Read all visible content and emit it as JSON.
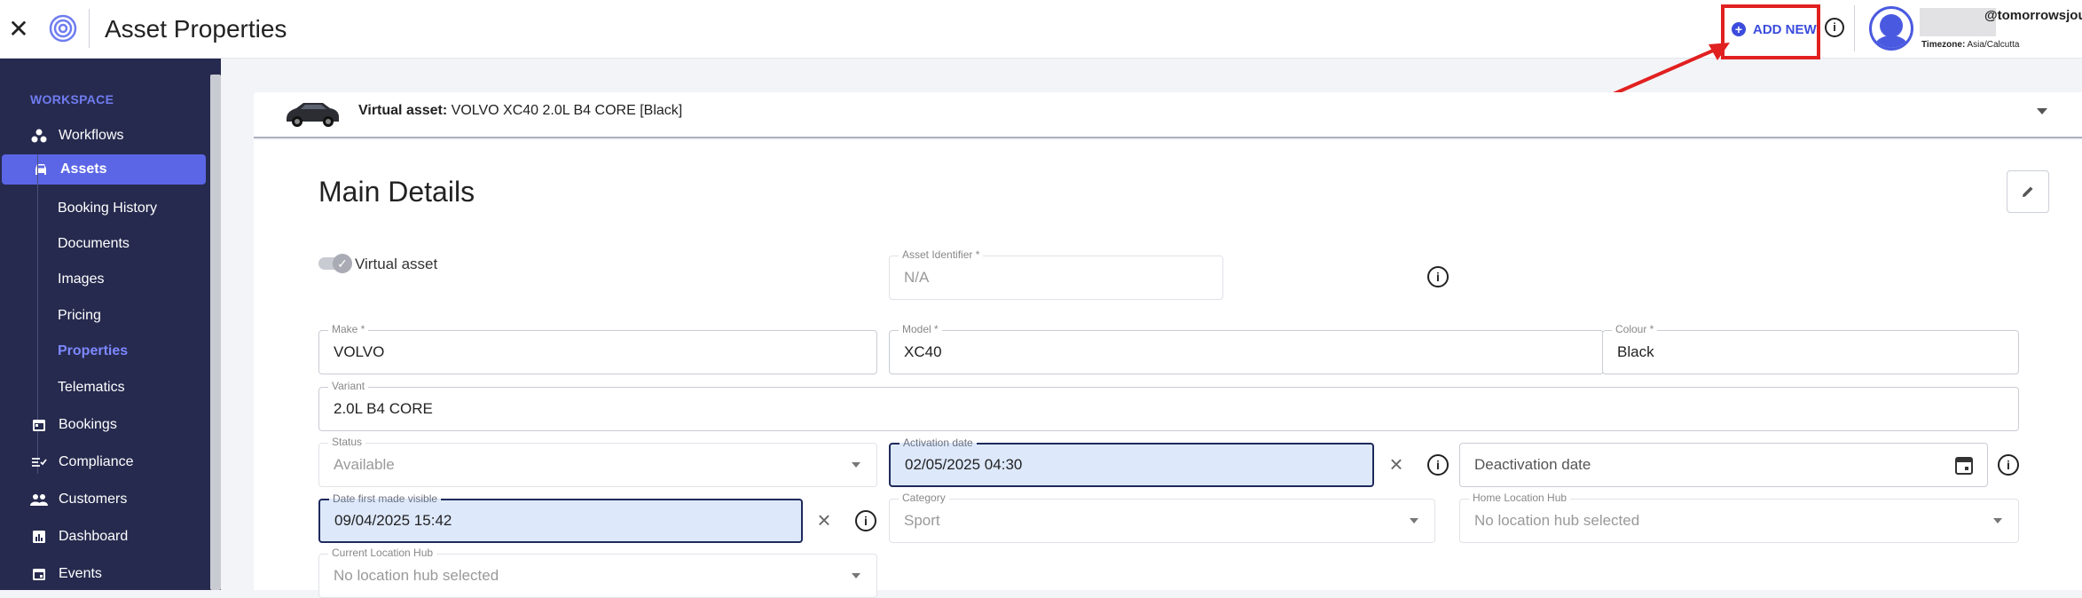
{
  "header": {
    "title": "Asset Properties",
    "add_new_label": "ADD NEW",
    "user_handle": "@tomorrowsjourn",
    "timezone_label": "Timezone:",
    "timezone_value": "Asia/Calcutta"
  },
  "sidebar": {
    "section_label": "WORKSPACE",
    "items": [
      {
        "label": "Workflows",
        "icon": "workflow-icon"
      },
      {
        "label": "Assets",
        "icon": "car-icon",
        "active": true
      },
      {
        "label": "Bookings",
        "icon": "calendar-icon"
      },
      {
        "label": "Compliance",
        "icon": "compliance-icon"
      },
      {
        "label": "Customers",
        "icon": "people-icon"
      },
      {
        "label": "Dashboard",
        "icon": "dashboard-icon"
      },
      {
        "label": "Events",
        "icon": "calendar-event-icon"
      }
    ],
    "sub_items": [
      {
        "label": "Booking History"
      },
      {
        "label": "Documents"
      },
      {
        "label": "Images"
      },
      {
        "label": "Pricing"
      },
      {
        "label": "Properties",
        "active": true
      },
      {
        "label": "Telematics"
      }
    ]
  },
  "banner": {
    "label": "Virtual asset:",
    "value": "VOLVO XC40 2.0L B4 CORE [Black]"
  },
  "main": {
    "section_title": "Main Details",
    "virtual_asset_label": "Virtual asset",
    "fields": {
      "asset_identifier": {
        "label": "Asset Identifier *",
        "value": "N/A"
      },
      "make": {
        "label": "Make *",
        "value": "VOLVO"
      },
      "model": {
        "label": "Model *",
        "value": "XC40"
      },
      "colour": {
        "label": "Colour *",
        "value": "Black"
      },
      "variant": {
        "label": "Variant",
        "value": "2.0L B4 CORE"
      },
      "status": {
        "label": "Status",
        "value": "Available"
      },
      "activation_date": {
        "label": "Activation date",
        "value": "02/05/2025 04:30"
      },
      "deactivation_date": {
        "placeholder": "Deactivation date"
      },
      "date_first_visible": {
        "label": "Date first made visible",
        "value": "09/04/2025 15:42"
      },
      "category": {
        "label": "Category",
        "value": "Sport"
      },
      "home_location_hub": {
        "label": "Home Location Hub",
        "value": "No location hub selected"
      },
      "current_location_hub": {
        "label": "Current Location Hub",
        "value": "No location hub selected"
      }
    }
  },
  "colors": {
    "sidebar_bg": "#262a4e",
    "accent": "#5b66e6",
    "highlight_field": "#dde8fb",
    "annotation_red": "#e12020"
  }
}
